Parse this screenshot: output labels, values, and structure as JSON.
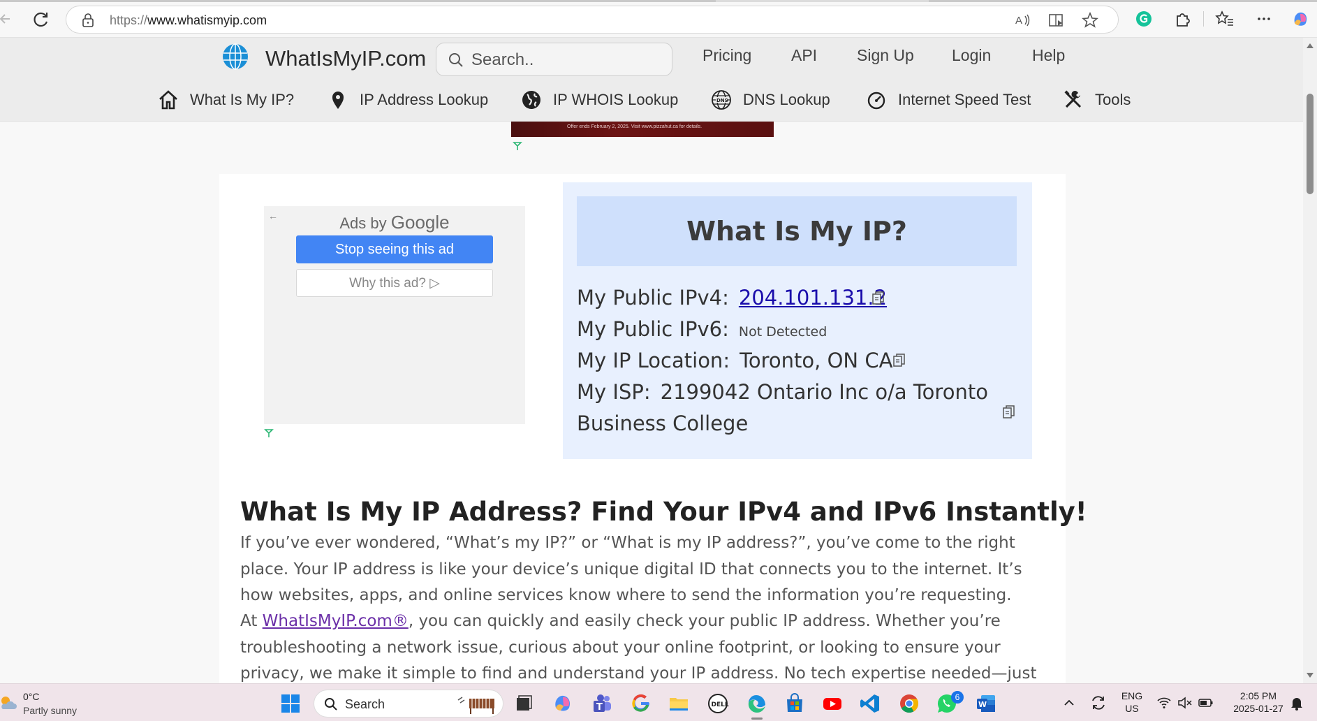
{
  "browser": {
    "url_protocol": "https://",
    "url_host": "www.whatismyip.com"
  },
  "site": {
    "logo_text": "WhatIsMyIP.com",
    "search_placeholder": "Search..",
    "top_links": [
      "Pricing",
      "API",
      "Sign Up",
      "Login",
      "Help"
    ],
    "main_nav": [
      {
        "label": "What Is My IP?",
        "icon": "home-icon"
      },
      {
        "label": "IP Address Lookup",
        "icon": "map-pin-icon"
      },
      {
        "label": "IP WHOIS Lookup",
        "icon": "globe-icon"
      },
      {
        "label": "DNS Lookup",
        "icon": "dns-globe-icon"
      },
      {
        "label": "Internet Speed Test",
        "icon": "speedometer-icon"
      },
      {
        "label": "Tools",
        "icon": "tools-icon"
      }
    ]
  },
  "banner_ad": {
    "fine_print": "Offer ends February 2, 2025. Visit www.pizzahut.ca for details."
  },
  "google_ad": {
    "ads_by": "Ads by",
    "google": "Google",
    "stop_label": "Stop seeing this ad",
    "why_label": "Why this ad? ▷"
  },
  "ip_panel": {
    "title": "What Is My IP?",
    "ipv4_label": "My Public IPv4:",
    "ipv4_value": "204.101.131.2",
    "ipv6_label": "My Public IPv6:",
    "ipv6_value": "Not Detected",
    "location_label": "My IP Location:",
    "location_value": "Toronto, ON CA",
    "isp_label": "My ISP:",
    "isp_value_line1": "2199042 Ontario Inc o/a Toronto",
    "isp_value_line2": "Business College"
  },
  "article": {
    "title": "What Is My IP Address? Find Your IPv4 and IPv6 Instantly!",
    "p1": "If you’ve ever wondered, “What’s my IP?” or “What is my IP address?”, you’ve come to the right place. Your IP address is like your device’s unique digital ID that connects you to the internet. It’s how websites, apps, and online services know where to send the information you’re requesting.",
    "p2_prefix": "At ",
    "p2_link": "WhatIsMyIP.com®",
    "p2_rest": ", you can quickly and easily check your public IP address. Whether you’re troubleshooting a network issue, curious about your online footprint, or looking to ensure your privacy, we make it simple to find and understand your IP address. No tech expertise needed—just visit, check, and go!"
  },
  "taskbar": {
    "weather_temp": "0°C",
    "weather_desc": "Partly sunny",
    "search_label": "Search",
    "whatsapp_badge": "6",
    "lang_top": "ENG",
    "lang_bottom": "US",
    "time": "2:05 PM",
    "date": "2025-01-27"
  },
  "colors": {
    "accent_blue": "#4285f4",
    "ip_panel_bg": "#e8f0fe",
    "ip_heading_bg": "#cfe0fc",
    "link_blue": "#1a0dab"
  }
}
